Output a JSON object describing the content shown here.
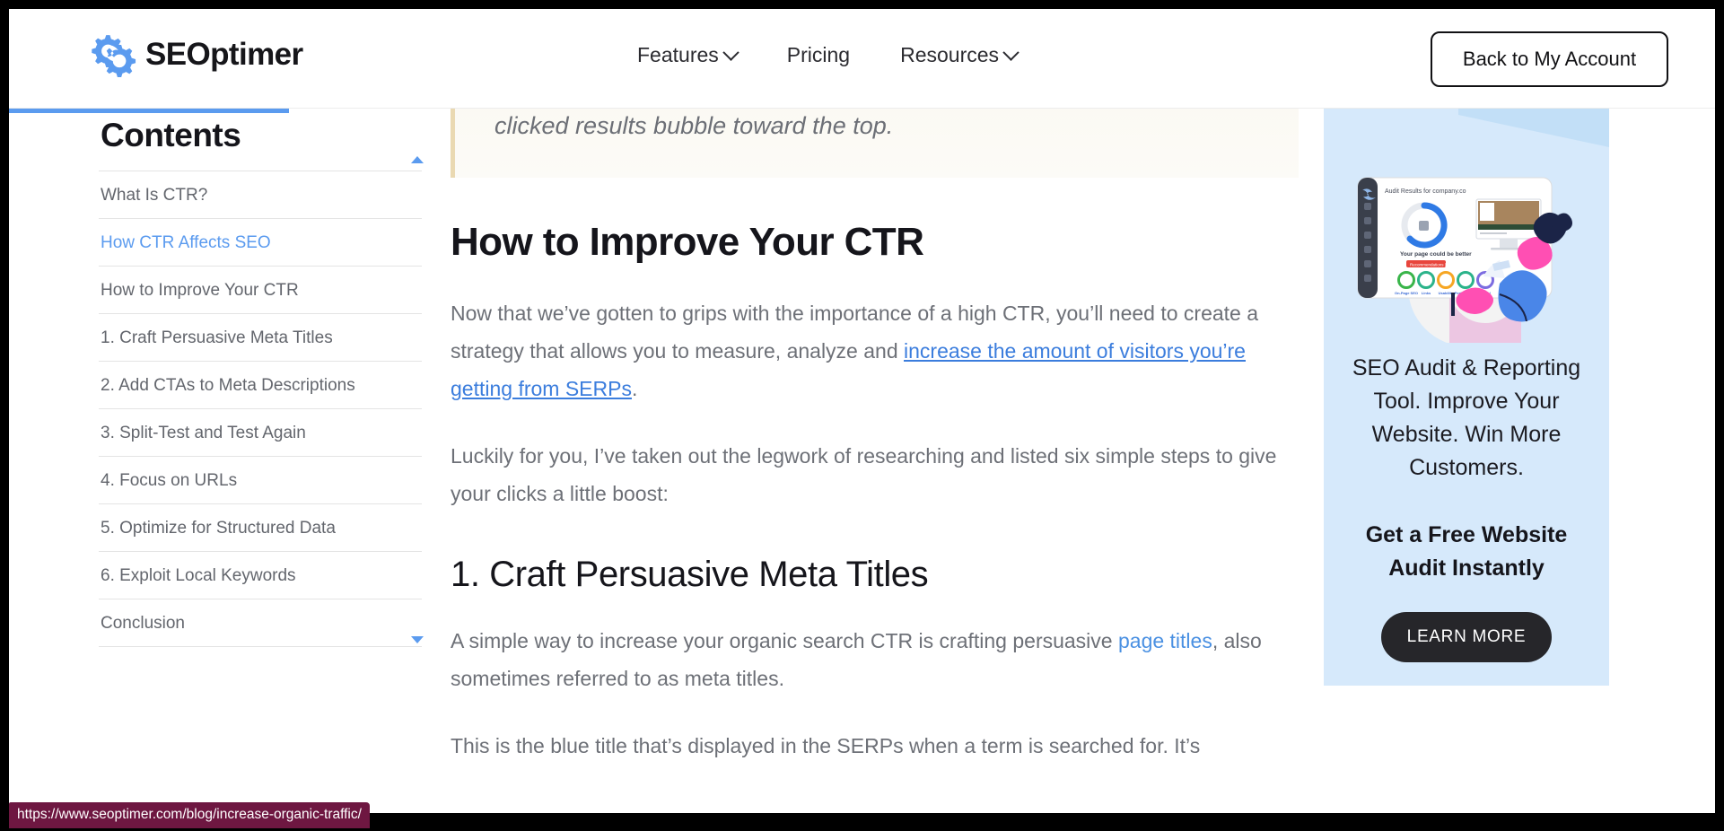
{
  "header": {
    "logo_text": "SEOptimer",
    "logo_icon": "gear-logo-icon",
    "nav": [
      {
        "label": "Features",
        "has_caret": true
      },
      {
        "label": "Pricing",
        "has_caret": false
      },
      {
        "label": "Resources",
        "has_caret": true
      }
    ],
    "account_button": "Back to My Account"
  },
  "reading_progress": {
    "percent": 16,
    "color": "#5b9bef"
  },
  "toc": {
    "title": "Contents",
    "scroll_up_icon": "triangle-up-icon",
    "scroll_down_icon": "triangle-down-icon",
    "items": [
      {
        "label": "What Is CTR?",
        "active": false
      },
      {
        "label": "How CTR Affects SEO",
        "active": true
      },
      {
        "label": "How to Improve Your CTR",
        "active": false
      },
      {
        "label": "1. Craft Persuasive Meta Titles",
        "active": false
      },
      {
        "label": "2. Add CTAs to Meta Descriptions",
        "active": false
      },
      {
        "label": "3. Split-Test and Test Again",
        "active": false
      },
      {
        "label": "4. Focus on URLs",
        "active": false
      },
      {
        "label": "5. Optimize for Structured Data",
        "active": false
      },
      {
        "label": "6. Exploit Local Keywords",
        "active": false
      },
      {
        "label": "Conclusion",
        "active": false
      }
    ]
  },
  "article": {
    "quote": "clicked results bubble toward the top.",
    "heading_1": "How to Improve Your CTR",
    "para_1_a": "Now that we’ve gotten to grips with the importance of a high CTR, you’ll need to create a strategy that allows you to measure, analyze and ",
    "para_1_link": "increase the amount of visitors you’re getting from SERPs",
    "para_1_b": ".",
    "para_2": "Luckily for you, I’ve taken out the legwork of researching and listed six simple steps to give your clicks a little boost:",
    "heading_2": "1. Craft Persuasive Meta Titles",
    "para_3_a": "A simple way to increase your organic search CTR is crafting persuasive ",
    "para_3_link": "page titles",
    "para_3_b": ", also sometimes referred to as meta titles.",
    "para_4": "This is the blue title that’s displayed in the SERPs when a term is searched for. It’s"
  },
  "ad": {
    "illustration_name": "seo-audit-dashboard-illustration",
    "headline": "SEO Audit & Reporting Tool. Improve Your Website. Win More Customers.",
    "subhead": "Get a Free Website Audit Instantly",
    "cta_label": "LEARN MORE",
    "background_color": "#d6e9fb",
    "cta_color": "#26262a"
  },
  "status_bar": {
    "url": "https://www.seoptimer.com/blog/increase-organic-traffic/",
    "background_color": "#6e1741"
  }
}
